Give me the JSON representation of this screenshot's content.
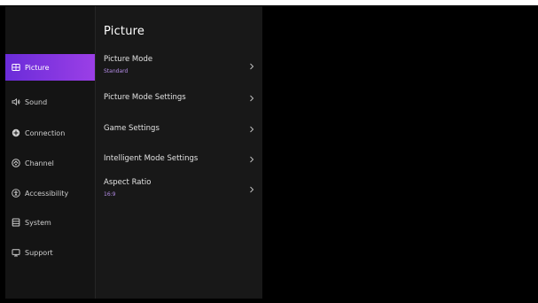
{
  "sidebar": {
    "items": [
      {
        "label": "Picture",
        "icon": "picture-icon",
        "active": true
      },
      {
        "label": "Sound",
        "icon": "sound-icon",
        "active": false
      },
      {
        "label": "Connection",
        "icon": "connection-icon",
        "active": false
      },
      {
        "label": "Channel",
        "icon": "channel-icon",
        "active": false
      },
      {
        "label": "Accessibility",
        "icon": "accessibility-icon",
        "active": false
      },
      {
        "label": "System",
        "icon": "system-icon",
        "active": false
      },
      {
        "label": "Support",
        "icon": "support-icon",
        "active": false
      }
    ]
  },
  "menu": {
    "title": "Picture",
    "items": [
      {
        "label": "Picture Mode",
        "value": "Standard"
      },
      {
        "label": "Picture Mode Settings",
        "value": ""
      },
      {
        "label": "Game Settings",
        "value": ""
      },
      {
        "label": "Intelligent Mode Settings",
        "value": ""
      },
      {
        "label": "Aspect Ratio",
        "value": "16:9"
      }
    ]
  },
  "colors": {
    "accent_start": "#6a2cd9",
    "accent_end": "#9b3fe6",
    "value_text": "#b48ce6",
    "panel": "#181818",
    "sidebar": "#141414"
  }
}
